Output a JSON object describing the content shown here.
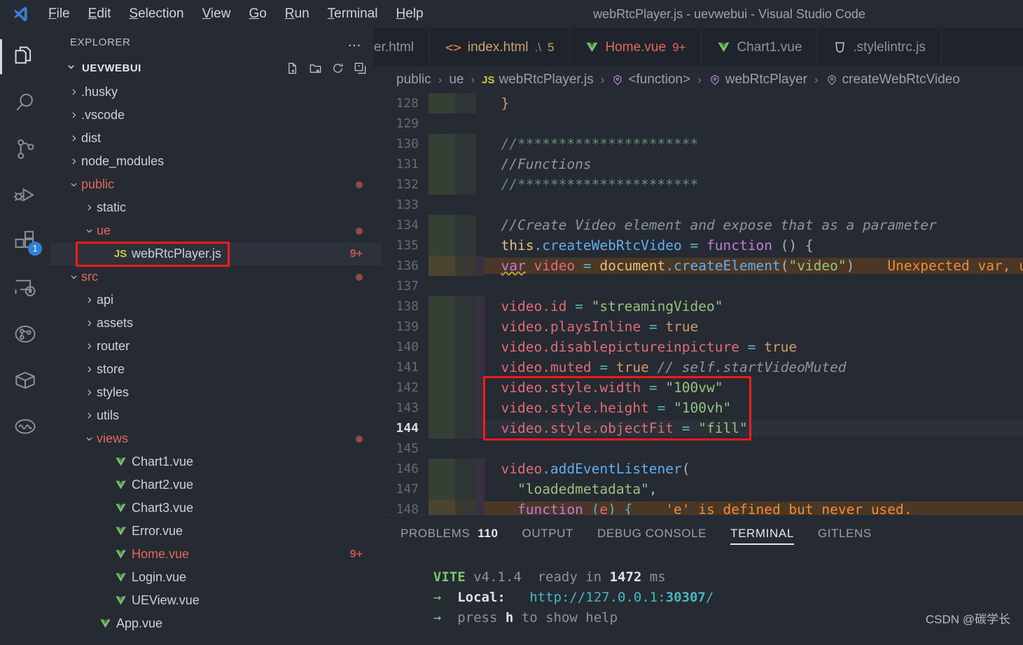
{
  "window": {
    "title": "webRtcPlayer.js - uevwebui - Visual Studio Code"
  },
  "menubar": {
    "items": [
      {
        "label": "File"
      },
      {
        "label": "Edit"
      },
      {
        "label": "Selection"
      },
      {
        "label": "View"
      },
      {
        "label": "Go"
      },
      {
        "label": "Run"
      },
      {
        "label": "Terminal"
      },
      {
        "label": "Help"
      }
    ]
  },
  "activitybar": {
    "items": [
      {
        "name": "explorer",
        "icon": "files-icon",
        "active": true,
        "badge": ""
      },
      {
        "name": "search",
        "icon": "search-icon",
        "active": false,
        "badge": ""
      },
      {
        "name": "source-control",
        "icon": "source-control-icon",
        "active": false,
        "badge": ""
      },
      {
        "name": "run-and-debug",
        "icon": "run-debug-icon",
        "active": false,
        "badge": ""
      },
      {
        "name": "extensions",
        "icon": "extensions-icon",
        "active": false,
        "badge": "1"
      },
      {
        "name": "remote-explorer",
        "icon": "remote-explorer-icon",
        "active": false,
        "badge": ""
      },
      {
        "name": "gitlens",
        "icon": "gitlens-icon",
        "active": false,
        "badge": ""
      },
      {
        "name": "package-explorer",
        "icon": "package-icon",
        "active": false,
        "badge": ""
      },
      {
        "name": "wave-tool",
        "icon": "wave-icon",
        "active": false,
        "badge": ""
      }
    ]
  },
  "sidebar": {
    "header_label": "EXPLORER",
    "more_actions": "…",
    "root_label": "UEVWEBUI",
    "root_actions": [
      {
        "name": "new-file-icon"
      },
      {
        "name": "new-folder-icon"
      },
      {
        "name": "refresh-icon"
      },
      {
        "name": "collapse-all-icon"
      }
    ],
    "tree": [
      {
        "label": ".husky",
        "indent": 0,
        "kind": "folder",
        "state": "collapsed",
        "modified": false,
        "badge": "",
        "selected": false
      },
      {
        "label": ".vscode",
        "indent": 0,
        "kind": "folder",
        "state": "collapsed",
        "modified": false,
        "badge": "",
        "selected": false
      },
      {
        "label": "dist",
        "indent": 0,
        "kind": "folder",
        "state": "collapsed",
        "modified": false,
        "badge": "",
        "selected": false
      },
      {
        "label": "node_modules",
        "indent": 0,
        "kind": "folder",
        "state": "collapsed",
        "modified": false,
        "badge": "",
        "selected": false
      },
      {
        "label": "public",
        "indent": 0,
        "kind": "folder",
        "state": "expanded",
        "modified": true,
        "badge": "",
        "selected": false
      },
      {
        "label": "static",
        "indent": 1,
        "kind": "folder",
        "state": "collapsed",
        "modified": false,
        "badge": "",
        "selected": false
      },
      {
        "label": "ue",
        "indent": 1,
        "kind": "folder",
        "state": "expanded",
        "modified": true,
        "badge": "",
        "selected": false
      },
      {
        "label": "webRtcPlayer.js",
        "indent": 2,
        "kind": "js",
        "state": "file",
        "modified": false,
        "badge": "9+",
        "selected": true
      },
      {
        "label": "src",
        "indent": 0,
        "kind": "folder",
        "state": "expanded",
        "modified": true,
        "badge": "",
        "selected": false
      },
      {
        "label": "api",
        "indent": 1,
        "kind": "folder",
        "state": "collapsed",
        "modified": false,
        "badge": "",
        "selected": false
      },
      {
        "label": "assets",
        "indent": 1,
        "kind": "folder",
        "state": "collapsed",
        "modified": false,
        "badge": "",
        "selected": false
      },
      {
        "label": "router",
        "indent": 1,
        "kind": "folder",
        "state": "collapsed",
        "modified": false,
        "badge": "",
        "selected": false
      },
      {
        "label": "store",
        "indent": 1,
        "kind": "folder",
        "state": "collapsed",
        "modified": false,
        "badge": "",
        "selected": false
      },
      {
        "label": "styles",
        "indent": 1,
        "kind": "folder",
        "state": "collapsed",
        "modified": false,
        "badge": "",
        "selected": false
      },
      {
        "label": "utils",
        "indent": 1,
        "kind": "folder",
        "state": "collapsed",
        "modified": false,
        "badge": "",
        "selected": false
      },
      {
        "label": "views",
        "indent": 1,
        "kind": "folder",
        "state": "expanded",
        "modified": true,
        "badge": "",
        "selected": false
      },
      {
        "label": "Chart1.vue",
        "indent": 2,
        "kind": "vue",
        "state": "file",
        "modified": false,
        "badge": "",
        "selected": false
      },
      {
        "label": "Chart2.vue",
        "indent": 2,
        "kind": "vue",
        "state": "file",
        "modified": false,
        "badge": "",
        "selected": false
      },
      {
        "label": "Chart3.vue",
        "indent": 2,
        "kind": "vue",
        "state": "file",
        "modified": false,
        "badge": "",
        "selected": false
      },
      {
        "label": "Error.vue",
        "indent": 2,
        "kind": "vue",
        "state": "file",
        "modified": false,
        "badge": "",
        "selected": false
      },
      {
        "label": "Home.vue",
        "indent": 2,
        "kind": "vue",
        "state": "file",
        "modified": true,
        "badge": "9+",
        "selected": false
      },
      {
        "label": "Login.vue",
        "indent": 2,
        "kind": "vue",
        "state": "file",
        "modified": false,
        "badge": "",
        "selected": false
      },
      {
        "label": "UEView.vue",
        "indent": 2,
        "kind": "vue",
        "state": "file",
        "modified": false,
        "badge": "",
        "selected": false
      },
      {
        "label": "App.vue",
        "indent": 1,
        "kind": "vue",
        "state": "file",
        "modified": false,
        "badge": "",
        "selected": false
      }
    ]
  },
  "tabs": [
    {
      "label": "er.html",
      "icon": "none",
      "sub": "",
      "count": "",
      "active": false,
      "modified": false
    },
    {
      "label": "index.html",
      "icon": "html-icon",
      "sub": ".\\",
      "count": "5",
      "active": false,
      "modified": false
    },
    {
      "label": "Home.vue",
      "icon": "vue-icon",
      "sub": "",
      "count": "9+",
      "active": false,
      "modified": true
    },
    {
      "label": "Chart1.vue",
      "icon": "vue-icon",
      "sub": "",
      "count": "",
      "active": false,
      "modified": false
    },
    {
      "label": ".stylelintrc.js",
      "icon": "stylelint-icon",
      "sub": "",
      "count": "",
      "active": false,
      "modified": false
    }
  ],
  "breadcrumb": [
    {
      "label": "public",
      "icon": "none"
    },
    {
      "label": "ue",
      "icon": "none"
    },
    {
      "label": "webRtcPlayer.js",
      "icon": "js-icon"
    },
    {
      "label": "<function>",
      "icon": "symbol-icon"
    },
    {
      "label": "webRtcPlayer",
      "icon": "symbol-icon"
    },
    {
      "label": "createWebRtcVideo",
      "icon": "symbol-icon"
    }
  ],
  "editor": {
    "current_line": 144,
    "lines": [
      {
        "num": "128",
        "gutter": "add",
        "indent": "none",
        "bg": "none",
        "tokens": [
          {
            "t": "  ",
            "c": "punc"
          },
          {
            "t": "}",
            "c": "brace"
          }
        ]
      },
      {
        "num": "129",
        "gutter": "none",
        "indent": "none",
        "bg": "none",
        "tokens": []
      },
      {
        "num": "130",
        "gutter": "add",
        "indent": "none",
        "bg": "none",
        "tokens": [
          {
            "t": "  //**********************",
            "c": "cmt"
          }
        ]
      },
      {
        "num": "131",
        "gutter": "add",
        "indent": "none",
        "bg": "none",
        "tokens": [
          {
            "t": "  //Functions",
            "c": "cmt2"
          }
        ]
      },
      {
        "num": "132",
        "gutter": "add",
        "indent": "none",
        "bg": "none",
        "tokens": [
          {
            "t": "  //**********************",
            "c": "cmt"
          }
        ]
      },
      {
        "num": "133",
        "gutter": "none",
        "indent": "none",
        "bg": "none",
        "tokens": []
      },
      {
        "num": "134",
        "gutter": "add",
        "indent": "none",
        "bg": "none",
        "tokens": [
          {
            "t": "  //Create Video element and expose that as a parameter",
            "c": "cmt2"
          }
        ]
      },
      {
        "num": "135",
        "gutter": "add",
        "indent": "none",
        "bg": "none",
        "tokens": [
          {
            "t": "  ",
            "c": "punc"
          },
          {
            "t": "this",
            "c": "this"
          },
          {
            "t": ".createWebRtcVideo",
            "c": "fn"
          },
          {
            "t": " = ",
            "c": "op"
          },
          {
            "t": "function",
            "c": "kw"
          },
          {
            "t": " () {",
            "c": "punc"
          }
        ]
      },
      {
        "num": "136",
        "gutter": "warn",
        "indent": "purple",
        "bg": "warn",
        "tokens": [
          {
            "t": "  ",
            "c": "punc"
          },
          {
            "t": "var",
            "c": "kw",
            "squiggle": true
          },
          {
            "t": " ",
            "c": "punc"
          },
          {
            "t": "video",
            "c": "var"
          },
          {
            "t": " = ",
            "c": "op"
          },
          {
            "t": "document",
            "c": "this"
          },
          {
            "t": ".createElement",
            "c": "fn"
          },
          {
            "t": "(",
            "c": "punc"
          },
          {
            "t": "\"video\"",
            "c": "str"
          },
          {
            "t": ")",
            "c": "punc"
          },
          {
            "t": "    Unexpected var, us",
            "c": "warn"
          }
        ]
      },
      {
        "num": "137",
        "gutter": "none",
        "indent": "none",
        "bg": "none",
        "tokens": []
      },
      {
        "num": "138",
        "gutter": "add",
        "indent": "purple",
        "bg": "none",
        "tokens": [
          {
            "t": "  ",
            "c": "punc"
          },
          {
            "t": "video",
            "c": "var"
          },
          {
            "t": ".id",
            "c": "var"
          },
          {
            "t": " = ",
            "c": "op"
          },
          {
            "t": "\"streamingVideo\"",
            "c": "str"
          }
        ]
      },
      {
        "num": "139",
        "gutter": "add",
        "indent": "purple",
        "bg": "none",
        "tokens": [
          {
            "t": "  ",
            "c": "punc"
          },
          {
            "t": "video",
            "c": "var"
          },
          {
            "t": ".playsInline",
            "c": "var"
          },
          {
            "t": " = ",
            "c": "op"
          },
          {
            "t": "true",
            "c": "num"
          }
        ]
      },
      {
        "num": "140",
        "gutter": "add",
        "indent": "purple",
        "bg": "none",
        "tokens": [
          {
            "t": "  ",
            "c": "punc"
          },
          {
            "t": "video",
            "c": "var"
          },
          {
            "t": ".disablepictureinpicture",
            "c": "var"
          },
          {
            "t": " = ",
            "c": "op"
          },
          {
            "t": "true",
            "c": "num"
          }
        ]
      },
      {
        "num": "141",
        "gutter": "add",
        "indent": "purple",
        "bg": "none",
        "tokens": [
          {
            "t": "  ",
            "c": "punc"
          },
          {
            "t": "video",
            "c": "var"
          },
          {
            "t": ".muted",
            "c": "var"
          },
          {
            "t": " = ",
            "c": "op"
          },
          {
            "t": "true",
            "c": "num"
          },
          {
            "t": " ",
            "c": "punc"
          },
          {
            "t": "// self.startVideoMuted",
            "c": "cmt2"
          }
        ]
      },
      {
        "num": "142",
        "gutter": "add",
        "indent": "purple",
        "bg": "none",
        "tokens": [
          {
            "t": "  ",
            "c": "punc"
          },
          {
            "t": "video",
            "c": "var"
          },
          {
            "t": ".style",
            "c": "var"
          },
          {
            "t": ".width",
            "c": "var"
          },
          {
            "t": " = ",
            "c": "op"
          },
          {
            "t": "\"100vw\"",
            "c": "str"
          }
        ]
      },
      {
        "num": "143",
        "gutter": "add",
        "indent": "purple",
        "bg": "none",
        "tokens": [
          {
            "t": "  ",
            "c": "punc"
          },
          {
            "t": "video",
            "c": "var"
          },
          {
            "t": ".style",
            "c": "var"
          },
          {
            "t": ".height",
            "c": "var"
          },
          {
            "t": " = ",
            "c": "op"
          },
          {
            "t": "\"100vh\"",
            "c": "str"
          }
        ]
      },
      {
        "num": "144",
        "gutter": "add",
        "indent": "purple",
        "bg": "cur",
        "tokens": [
          {
            "t": "  ",
            "c": "punc"
          },
          {
            "t": "video",
            "c": "var"
          },
          {
            "t": ".style",
            "c": "var"
          },
          {
            "t": ".objectFit",
            "c": "var"
          },
          {
            "t": " = ",
            "c": "op"
          },
          {
            "t": "\"fill\"",
            "c": "str"
          }
        ]
      },
      {
        "num": "145",
        "gutter": "none",
        "indent": "none",
        "bg": "none",
        "tokens": []
      },
      {
        "num": "146",
        "gutter": "add",
        "indent": "purple",
        "bg": "none",
        "tokens": [
          {
            "t": "  ",
            "c": "punc"
          },
          {
            "t": "video",
            "c": "var"
          },
          {
            "t": ".addEventListener",
            "c": "fn"
          },
          {
            "t": "(",
            "c": "punc"
          }
        ]
      },
      {
        "num": "147",
        "gutter": "add",
        "indent": "purple",
        "bg": "none",
        "tokens": [
          {
            "t": "    ",
            "c": "punc"
          },
          {
            "t": "\"loadedmetadata\"",
            "c": "str"
          },
          {
            "t": ",",
            "c": "punc"
          }
        ]
      },
      {
        "num": "148",
        "gutter": "warn",
        "indent": "purple",
        "bg": "warn",
        "tokens": [
          {
            "t": "    ",
            "c": "punc"
          },
          {
            "t": "function",
            "c": "kw"
          },
          {
            "t": " (",
            "c": "op"
          },
          {
            "t": "e",
            "c": "var",
            "squiggle": true
          },
          {
            "t": ") {",
            "c": "op"
          },
          {
            "t": "    'e' is defined but never used.",
            "c": "warn"
          }
        ]
      }
    ]
  },
  "panel": {
    "tabs": [
      {
        "label": "PROBLEMS",
        "count": "110",
        "active": false
      },
      {
        "label": "OUTPUT",
        "count": "",
        "active": false
      },
      {
        "label": "DEBUG CONSOLE",
        "count": "",
        "active": false
      },
      {
        "label": "TERMINAL",
        "count": "",
        "active": true
      },
      {
        "label": "GITLENS",
        "count": "",
        "active": false
      }
    ],
    "terminal": {
      "lines": [
        [
          {
            "t": "  ",
            "c": "dim"
          },
          {
            "t": "VITE",
            "c": "green"
          },
          {
            "t": " v4.1.4",
            "c": "dim"
          },
          {
            "t": "  ready in ",
            "c": "dim"
          },
          {
            "t": "1472",
            "c": "white"
          },
          {
            "t": " ms",
            "c": "dim"
          }
        ],
        [
          {
            "t": "",
            "c": "dim"
          }
        ],
        [
          {
            "t": "  ",
            "c": "dim"
          },
          {
            "t": "→",
            "c": "arrow"
          },
          {
            "t": "  ",
            "c": "dim"
          },
          {
            "t": "Local:",
            "c": "white"
          },
          {
            "t": "   ",
            "c": "dim"
          },
          {
            "t": "http://127.0.0.1:",
            "c": "cyan"
          },
          {
            "t": "30307",
            "c": "cyanb"
          },
          {
            "t": "/",
            "c": "cyan"
          }
        ],
        [
          {
            "t": "  ",
            "c": "dim"
          },
          {
            "t": "→",
            "c": "arrow"
          },
          {
            "t": "  ",
            "c": "dim"
          },
          {
            "t": "press ",
            "c": "dim"
          },
          {
            "t": "h",
            "c": "key"
          },
          {
            "t": " to show help",
            "c": "dim"
          }
        ]
      ]
    }
  },
  "watermark": {
    "text": "CSDN @碳学长"
  },
  "colors": {
    "highlight_box": "#f41b1b",
    "accent_blue": "#2f80d8",
    "modified_red": "#e4685a",
    "vue_green": "#7ec46f"
  }
}
